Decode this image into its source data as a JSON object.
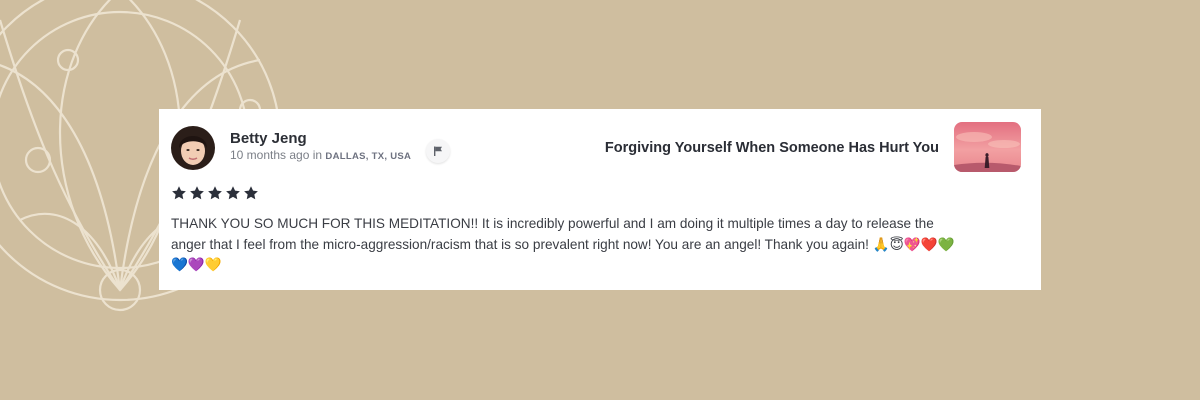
{
  "review": {
    "author": {
      "name": "Betty Jeng",
      "time_ago": "10 months ago",
      "in_text": "in",
      "location": "DALLAS, TX, USA"
    },
    "course": {
      "title": "Forgiving Yourself When Someone Has Hurt You"
    },
    "rating": 5,
    "rating_max": 5,
    "text": "THANK YOU SO MUCH FOR THIS MEDITATION!! It is incredibly powerful and I am doing it multiple times a day to release the anger that I feel from the micro-aggression/racism that is so prevalent right now! You are an angel! Thank you again! 🙏😇💖❤️💚💙💜💛"
  },
  "icons": {
    "flag": "flag-icon",
    "star": "star-icon"
  },
  "colors": {
    "background": "#cfbe9f",
    "card": "#ffffff",
    "star": "#2b2f3a",
    "ornament": "#ece2cf"
  }
}
